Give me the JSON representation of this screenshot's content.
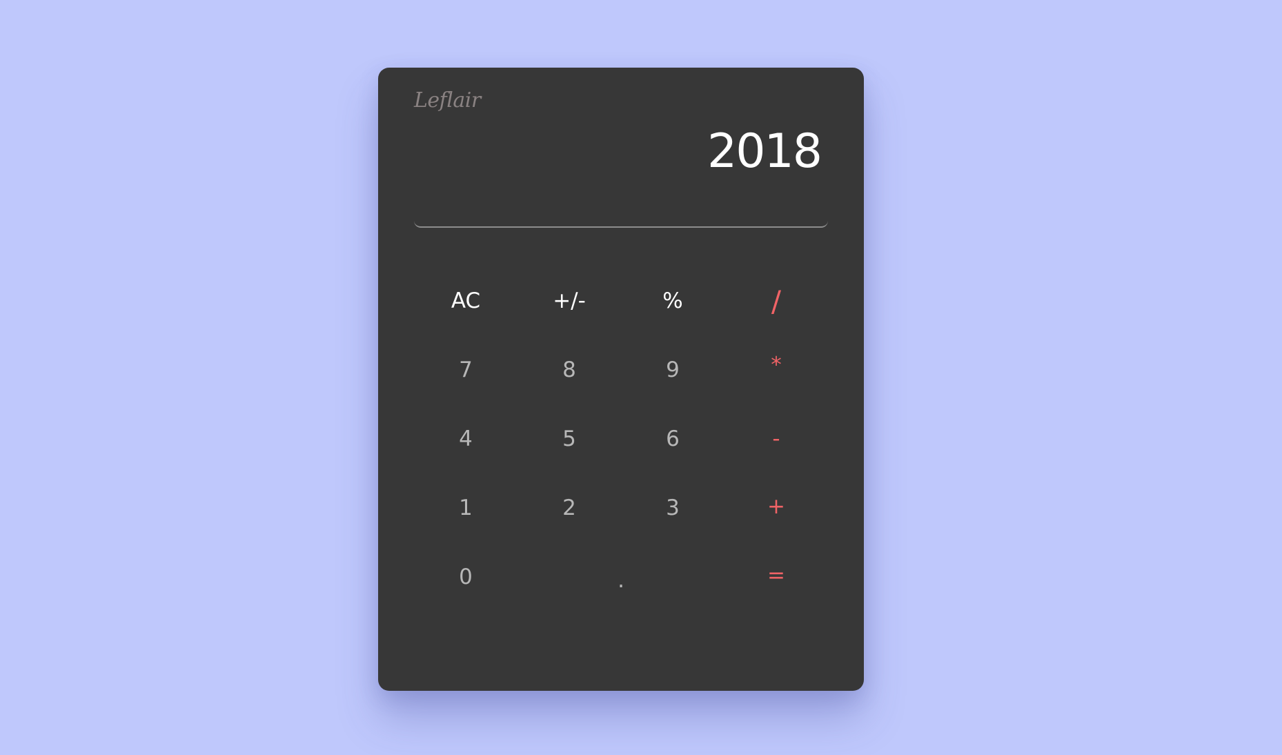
{
  "brand": "Leflair",
  "display": {
    "value": "2018"
  },
  "colors": {
    "background": "#bfc8fc",
    "panel": "#373737",
    "display_text": "#ffffff",
    "function_text": "#ffffff",
    "number_text": "#b7b7b7",
    "operator_text": "#f06366"
  },
  "keys": {
    "clear": "AC",
    "negate": "+/-",
    "percent": "%",
    "divide": "/",
    "seven": "7",
    "eight": "8",
    "nine": "9",
    "multiply": "*",
    "four": "4",
    "five": "5",
    "six": "6",
    "subtract": "-",
    "one": "1",
    "two": "2",
    "three": "3",
    "add": "+",
    "zero": "0",
    "decimal": ".",
    "equals": "="
  }
}
